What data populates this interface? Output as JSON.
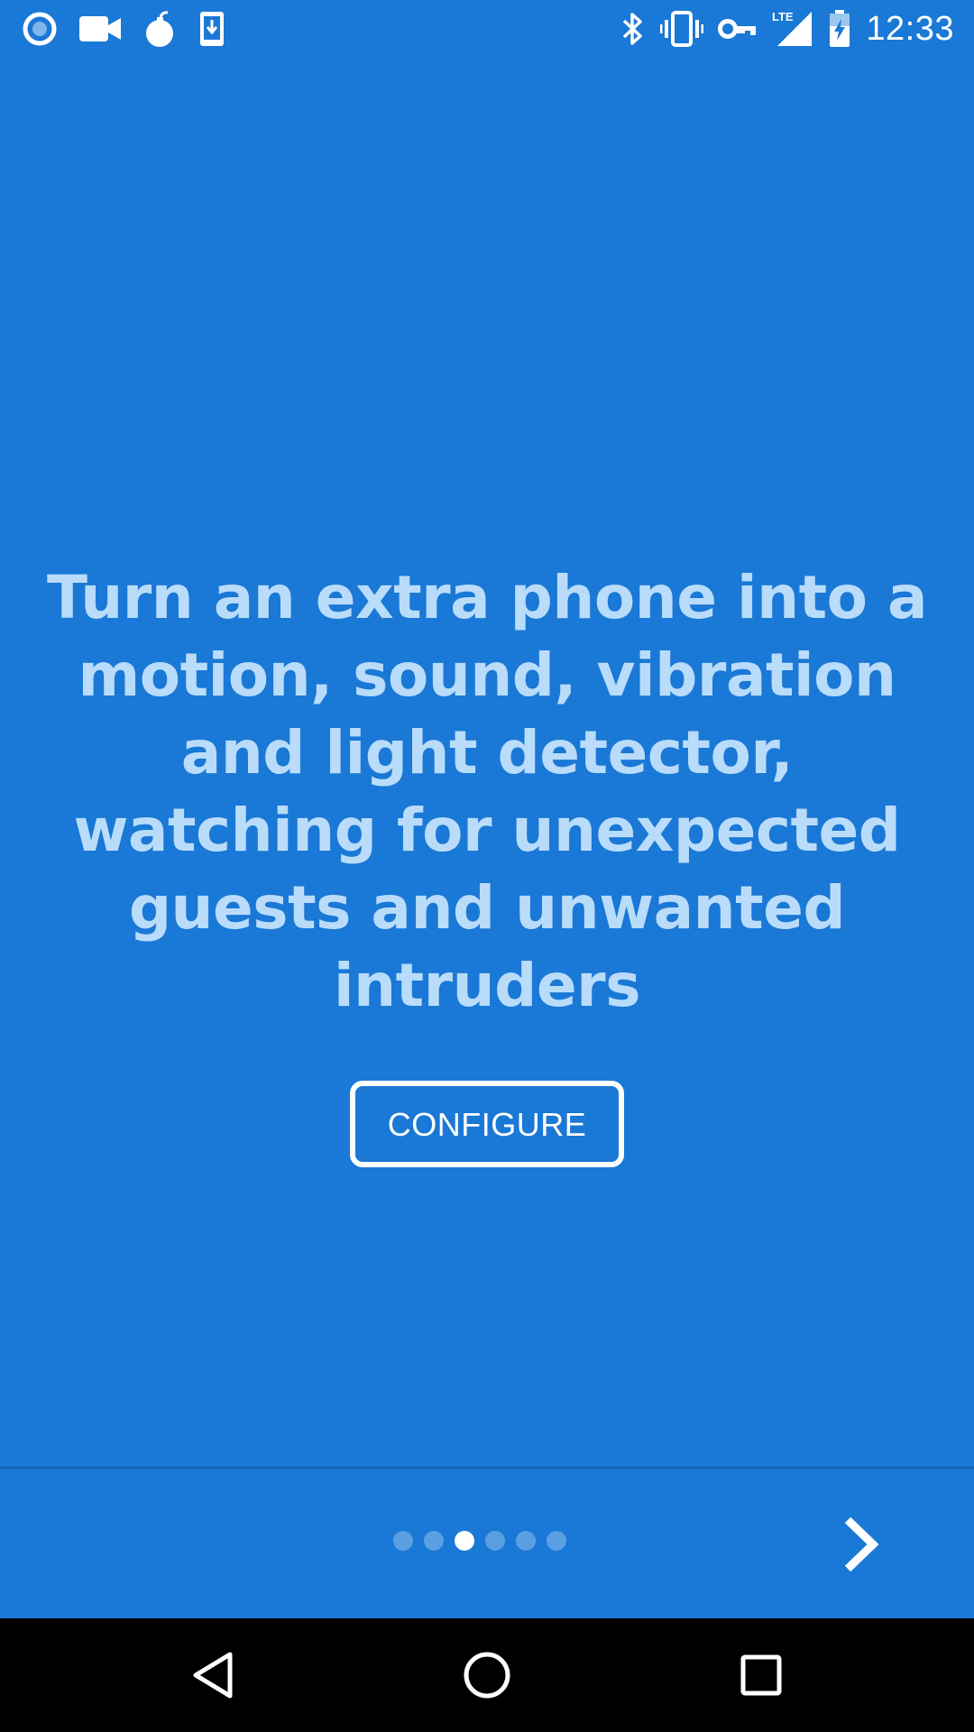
{
  "status_bar": {
    "time": "12:33",
    "left_icons": [
      "record-icon",
      "video-camera-icon",
      "bomb-icon",
      "download-phone-icon"
    ],
    "right_icons": [
      "bluetooth-icon",
      "vibrate-icon",
      "vpn-key-icon",
      "lte-signal-icon",
      "battery-charging-icon"
    ],
    "network_label": "LTE"
  },
  "main": {
    "headline": "Turn an extra phone into a motion, sound, vibration and light detector, watching for unexpected guests and unwanted intruders",
    "configure_label": "CONFIGURE"
  },
  "pager": {
    "page_count": 6,
    "current_page": 3,
    "next_icon": "chevron-right-icon"
  },
  "nav_bar": {
    "buttons": [
      "back-icon",
      "home-icon",
      "recents-icon"
    ]
  },
  "colors": {
    "background": "#1a78d6",
    "headline_text": "#b9dcfa",
    "accent_white": "#ffffff",
    "dot_inactive": "#5b9fe3"
  }
}
